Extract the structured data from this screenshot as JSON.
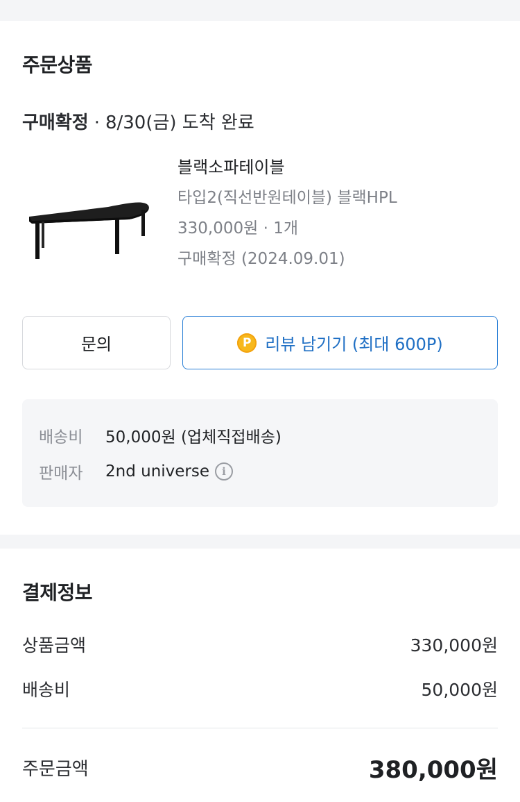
{
  "order": {
    "title": "주문상품",
    "status": {
      "label": "구매확정",
      "separator": "·",
      "detail": "8/30(금) 도착 완료"
    },
    "product": {
      "name": "블랙소파테이블",
      "option": "타입2(직선반원테이블) 블랙HPL",
      "price_qty": "330,000원 · 1개",
      "confirm_status": "구매확정 (2024.09.01)"
    },
    "buttons": {
      "inquiry": "문의",
      "review": "리뷰 남기기 (최대 600P)",
      "point_icon_text": "P"
    },
    "info": {
      "shipping_label": "배송비",
      "shipping_value": "50,000원 (업체직접배송)",
      "seller_label": "판매자",
      "seller_value": "2nd universe",
      "info_icon_text": "i"
    }
  },
  "payment": {
    "title": "결제정보",
    "rows": [
      {
        "label": "상품금액",
        "value": "330,000원"
      },
      {
        "label": "배송비",
        "value": "50,000원"
      }
    ],
    "total": {
      "label": "주문금액",
      "value": "380,000원"
    }
  },
  "colors": {
    "accent_blue": "#2a7fd6",
    "point_yellow": "#f7b81c",
    "muted_text": "#7d8087",
    "background": "#f4f5f7"
  },
  "icons": {
    "point": "point-coin-icon",
    "info": "info-circle-icon"
  }
}
